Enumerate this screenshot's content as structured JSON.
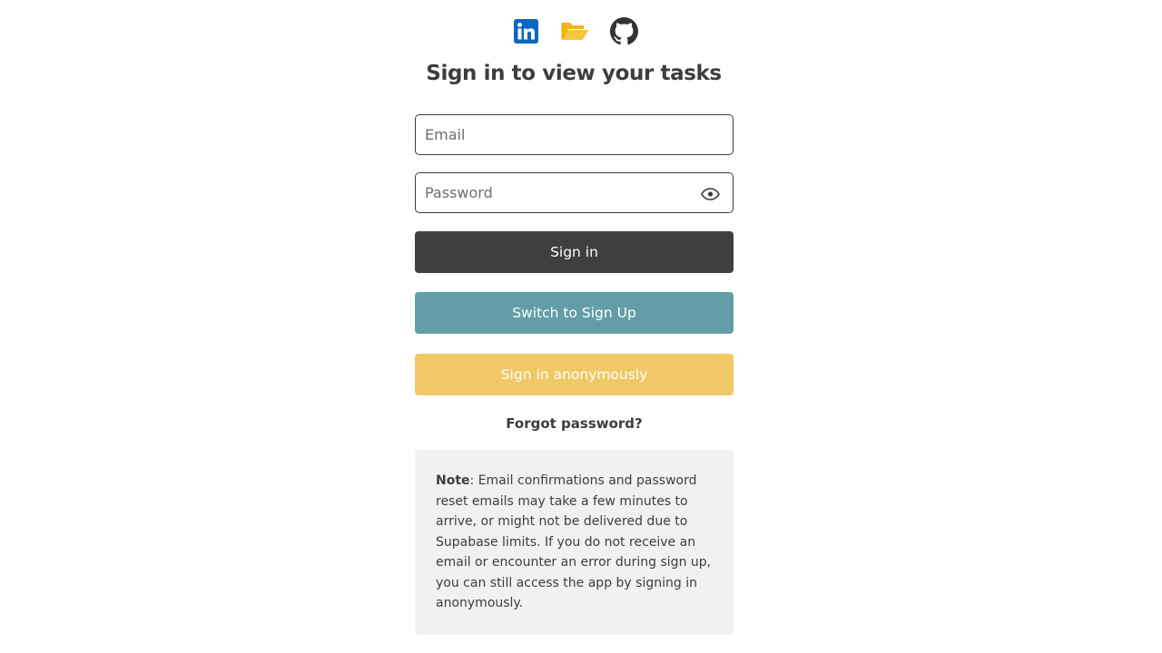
{
  "icons": [
    {
      "name": "linkedin-icon",
      "color": "#0a66c2"
    },
    {
      "name": "folder-open-icon",
      "color": "#f5b50a"
    },
    {
      "name": "github-icon",
      "color": "#333333"
    }
  ],
  "heading": "Sign in to view your tasks",
  "form": {
    "email_placeholder": "Email",
    "email_value": "",
    "password_placeholder": "Password",
    "password_value": "",
    "password_toggle_icon": "eye-icon"
  },
  "buttons": {
    "sign_in": "Sign in",
    "switch_to_sign_up": "Switch to Sign Up",
    "sign_in_anonymously": "Sign in anonymously"
  },
  "forgot_password": "Forgot password?",
  "note": {
    "label": "Note",
    "text": ": Email confirmations and password reset emails may take a few minutes to arrive, or might not be delivered due to Supabase limits. If you do not receive an email or encounter an error during sign up, you can still access the app by signing in anonymously."
  },
  "colors": {
    "sign_in_button": "#3f3f3f",
    "switch_button": "#639ea8",
    "anonymous_button": "#f0c966",
    "note_background": "#f1f1f1",
    "text": "#3d3d3d"
  }
}
